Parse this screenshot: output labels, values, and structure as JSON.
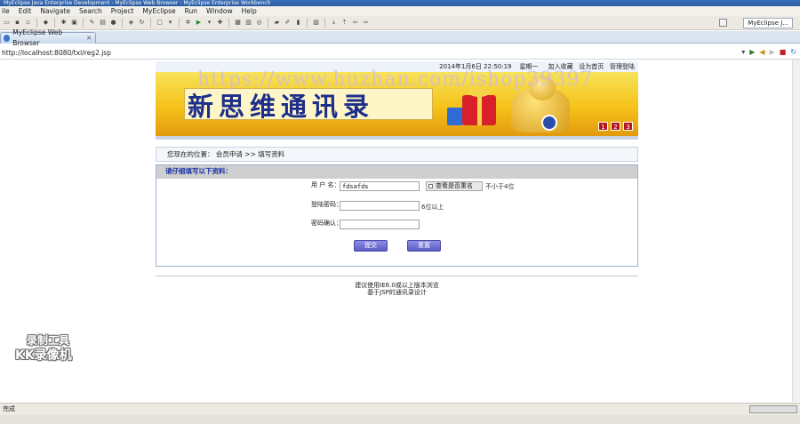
{
  "window": {
    "title": "MyEclipse Java Enterprise Development - MyEclipse Web Browser - MyEclipse Enterprise Workbench"
  },
  "menu": [
    "ile",
    "Edit",
    "Navigate",
    "Search",
    "Project",
    "MyEclipse",
    "Run",
    "Window",
    "Help"
  ],
  "perspective": {
    "label": "MyEclipse J..."
  },
  "browser": {
    "tab_label": "MyEclipse Web Browser",
    "url": "http://localhost:8080/txl/reg2.jsp"
  },
  "status": {
    "text": "完成"
  },
  "page": {
    "datetime": "2014年1月6日 22:50:19",
    "weekday": "星期一",
    "top_links": [
      "加入收藏",
      "设为首页",
      "管理登陆"
    ],
    "banner_title": "新思维通讯录",
    "banner_nums": [
      "1",
      "2",
      "3"
    ],
    "breadcrumb": {
      "prefix": "您现在的位置：",
      "section": "会员申请",
      "separator": " >> ",
      "current": "填写资料"
    },
    "form_heading": "请仔细填写以下资料：",
    "fields": {
      "username_label": "用 户 名：",
      "username_value": "fdsafds",
      "check_button": "查看是否重名",
      "username_hint": "不小于4位",
      "password_label": "登陆密码：",
      "password_hint": "6位以上",
      "confirm_label": "密码确认："
    },
    "buttons": {
      "submit": "提交",
      "reset": "重置"
    },
    "footer": [
      "建议使用IE6.0或以上版本浏览",
      "基于JSP的通讯录设计"
    ]
  },
  "watermarks": {
    "url_text": "https://www.huzhan.com/ishop39397",
    "recorder_line1": "录制工具",
    "recorder_line2": "KK录像机"
  }
}
